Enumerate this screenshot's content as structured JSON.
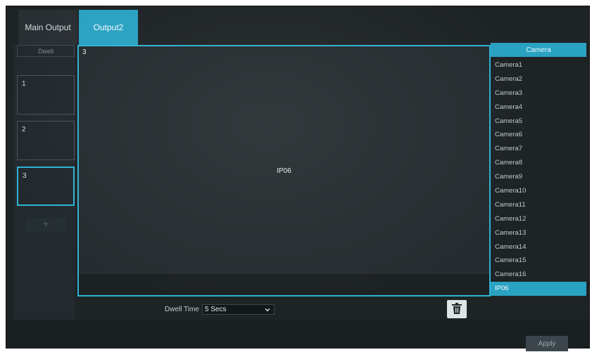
{
  "tabs": [
    {
      "label": "Main Output",
      "active": false
    },
    {
      "label": "Output2",
      "active": true
    }
  ],
  "dwell": {
    "header": "Dwell",
    "sequences": [
      {
        "label": "1",
        "active": false
      },
      {
        "label": "2",
        "active": false
      },
      {
        "label": "3",
        "active": true
      }
    ],
    "add_label": "+"
  },
  "preview": {
    "number": "3",
    "channel": "IP06"
  },
  "cameras": {
    "header": "Camera",
    "items": [
      "Camera1",
      "Camera2",
      "Camera3",
      "Camera4",
      "Camera5",
      "Camera6",
      "Camera7",
      "Camera8",
      "Camera9",
      "Camera10",
      "Camera11",
      "Camera12",
      "Camera13",
      "Camera14",
      "Camera15",
      "Camera16",
      "IP06"
    ],
    "selected": "IP06"
  },
  "dwell_time": {
    "label": "Dwell Time",
    "value": "5 Secs"
  },
  "apply_label": "Apply",
  "colors": {
    "accent": "#2aa2c2",
    "background": "#1e2326"
  }
}
